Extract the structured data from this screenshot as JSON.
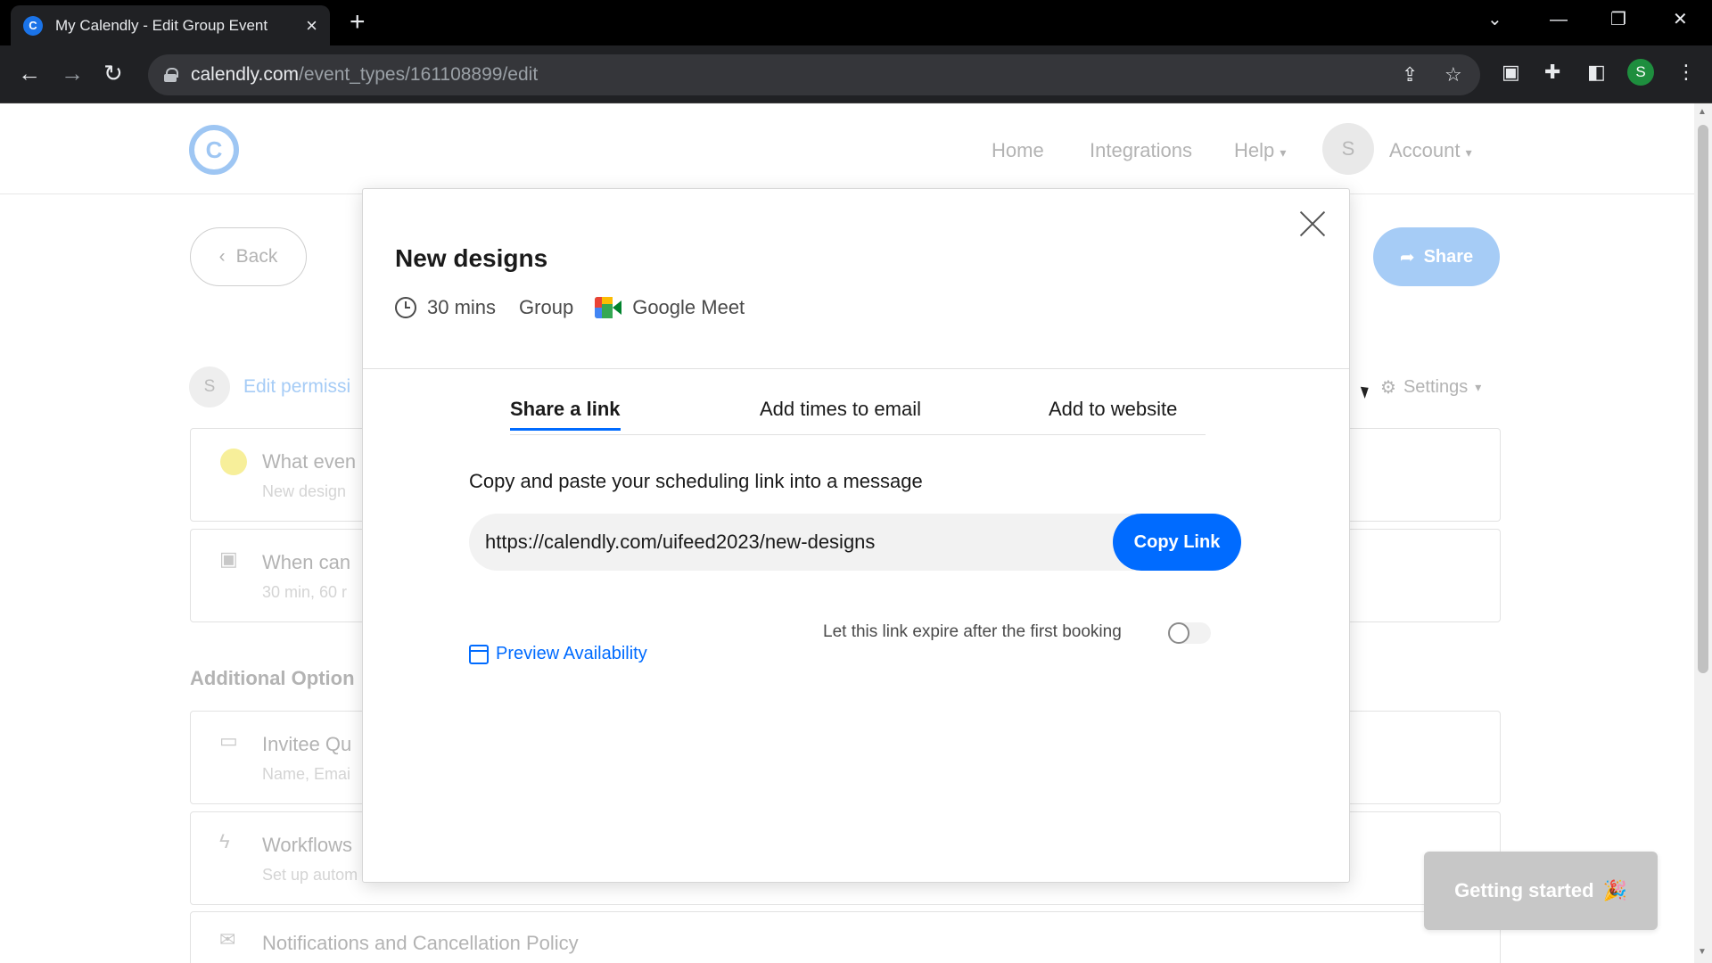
{
  "browser": {
    "tab_title": "My Calendly - Edit Group Event",
    "tab_favicon": "C",
    "url_host": "calendly.com",
    "url_path": "/event_types/161108899/edit",
    "profile_initial": "S"
  },
  "header": {
    "nav": [
      "Home",
      "Integrations",
      "Help",
      "Account"
    ],
    "avatar_initial": "S"
  },
  "page": {
    "back_label": "Back",
    "share_label": "Share",
    "perm_initial": "S",
    "perm_text": "Edit permissi",
    "settings_label": "Settings",
    "cards": [
      {
        "title": "What even",
        "subtitle": "New design"
      },
      {
        "title": "When can",
        "subtitle": "30 min, 60 r"
      }
    ],
    "additional_label": "Additional Option",
    "option_cards": [
      {
        "title": "Invitee Qu",
        "subtitle": "Name, Emai"
      },
      {
        "title": "Workflows",
        "subtitle": "Set up autom"
      },
      {
        "title": "Notifications and Cancellation Policy",
        "subtitle": ""
      }
    ],
    "getting_started": "Getting started"
  },
  "modal": {
    "title": "New designs",
    "duration": "30 mins",
    "event_type": "Group",
    "location": "Google Meet",
    "tabs": [
      "Share a link",
      "Add times to email",
      "Add to website"
    ],
    "active_tab": 0,
    "instruction": "Copy and paste your scheduling link into a message",
    "link_value": "https://calendly.com/uifeed2023/new-designs",
    "copy_label": "Copy Link",
    "expire_label": "Let this link expire after the first booking",
    "expire_enabled": false,
    "preview_label": "Preview Availability"
  },
  "colors": {
    "primary": "#006bff",
    "share_faded": "#a6ccf6"
  }
}
